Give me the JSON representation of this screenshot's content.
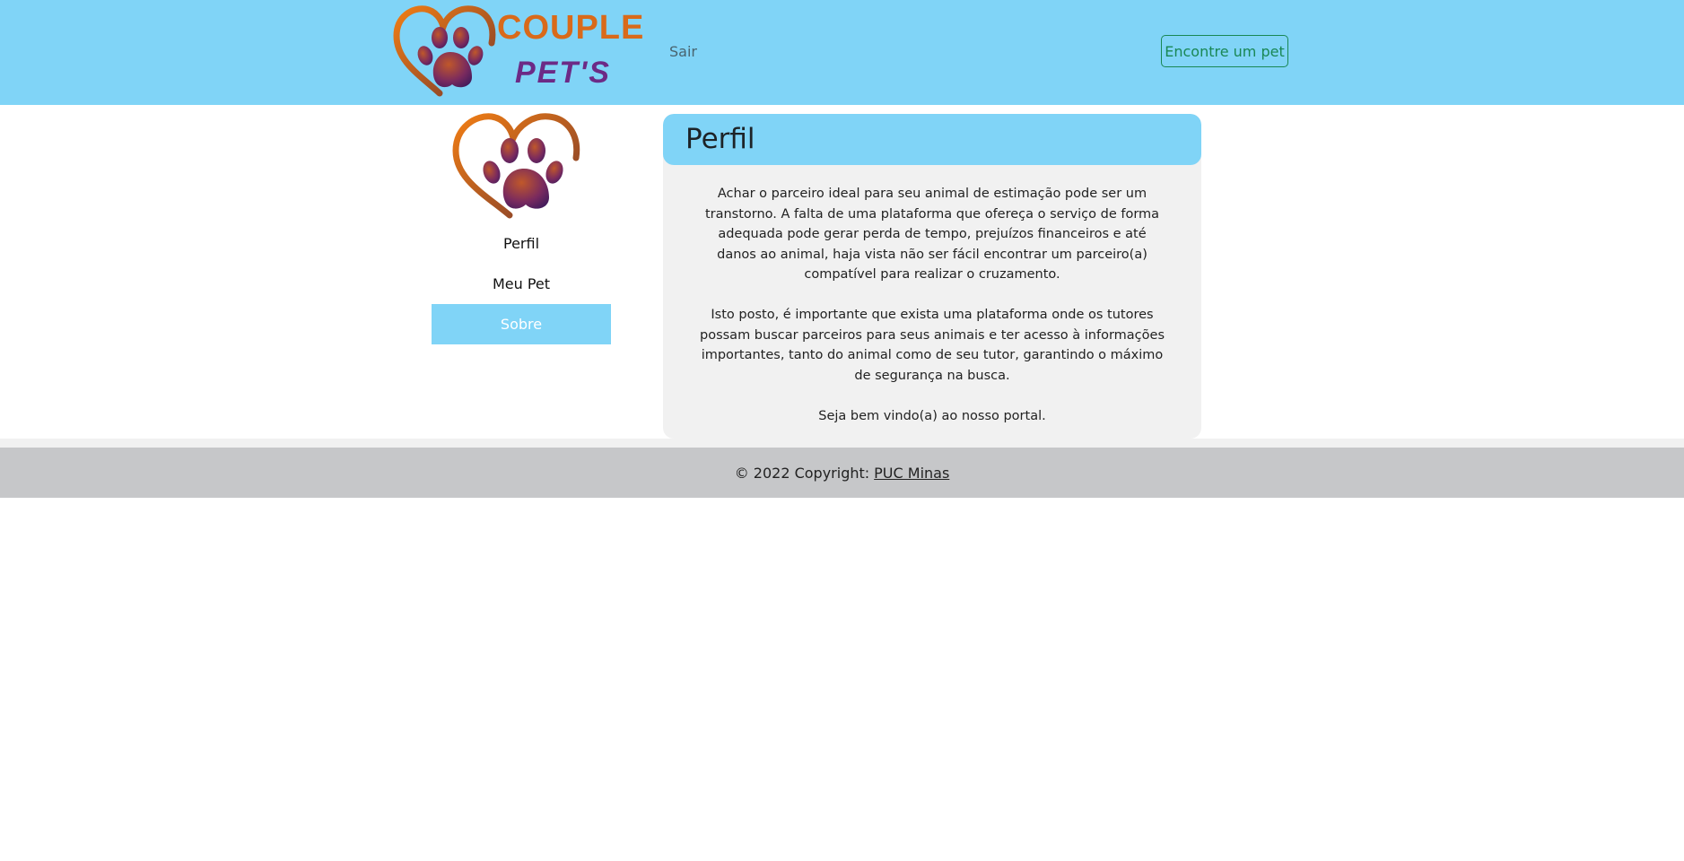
{
  "header": {
    "logo_text_line1": "COUPLE",
    "logo_text_line2": "PET'S",
    "nav_logout": "Sair",
    "find_pet_button": "Encontre um pet"
  },
  "sidebar": {
    "items": [
      {
        "label": "Perfil",
        "active": false
      },
      {
        "label": "Meu Pet",
        "active": false
      },
      {
        "label": "Sobre",
        "active": true
      }
    ]
  },
  "main": {
    "title": "Perfil",
    "paragraphs": [
      "Achar o parceiro ideal para seu animal de estimação pode ser um transtorno. A falta de uma plataforma que ofereça o serviço de forma adequada pode gerar perda de tempo, prejuízos financeiros e até danos ao animal, haja vista não ser fácil encontrar um parceiro(a) compatível para realizar o cruzamento.",
      "Isto posto, é importante que exista uma plataforma onde os tutores possam buscar parceiros para seus animais e ter acesso à informações importantes, tanto do animal como de seu tutor, garantindo o máximo de segurança na busca.",
      "Seja bem vindo(a) ao nosso portal."
    ]
  },
  "footer": {
    "copyright_prefix": "© 2022 Copyright:",
    "link_text": "PUC Minas"
  },
  "colors": {
    "header_bg": "#80d4f7",
    "active_item_bg": "#80d4f7",
    "button_green": "#198754",
    "footer_bg": "#c6c7c9",
    "card_bg": "#f1f1f1",
    "logo_orange": "#d96a1a",
    "logo_purple": "#6c2a86"
  }
}
